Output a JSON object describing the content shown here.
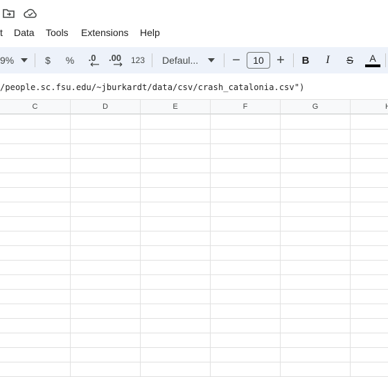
{
  "menubar": {
    "items": [
      "t",
      "Data",
      "Tools",
      "Extensions",
      "Help"
    ]
  },
  "titlebar": {
    "icons": [
      "move-to-folder-icon",
      "cloud-status-icon"
    ]
  },
  "toolbar": {
    "zoom": "9%",
    "currency": "$",
    "percent": "%",
    "decrease_decimal": ".0",
    "increase_decimal": ".00",
    "number_format": "123",
    "font": "Defaul...",
    "font_size": "10",
    "minus": "−",
    "plus": "+",
    "bold": "B",
    "italic": "I",
    "strike": "S",
    "text_color": "A",
    "text_color_value": "#000000"
  },
  "formula": {
    "text": "/people.sc.fsu.edu/~jburkardt/data/csv/crash_catalonia.csv\")"
  },
  "columns": [
    "C",
    "D",
    "E",
    "F",
    "G",
    "H"
  ]
}
